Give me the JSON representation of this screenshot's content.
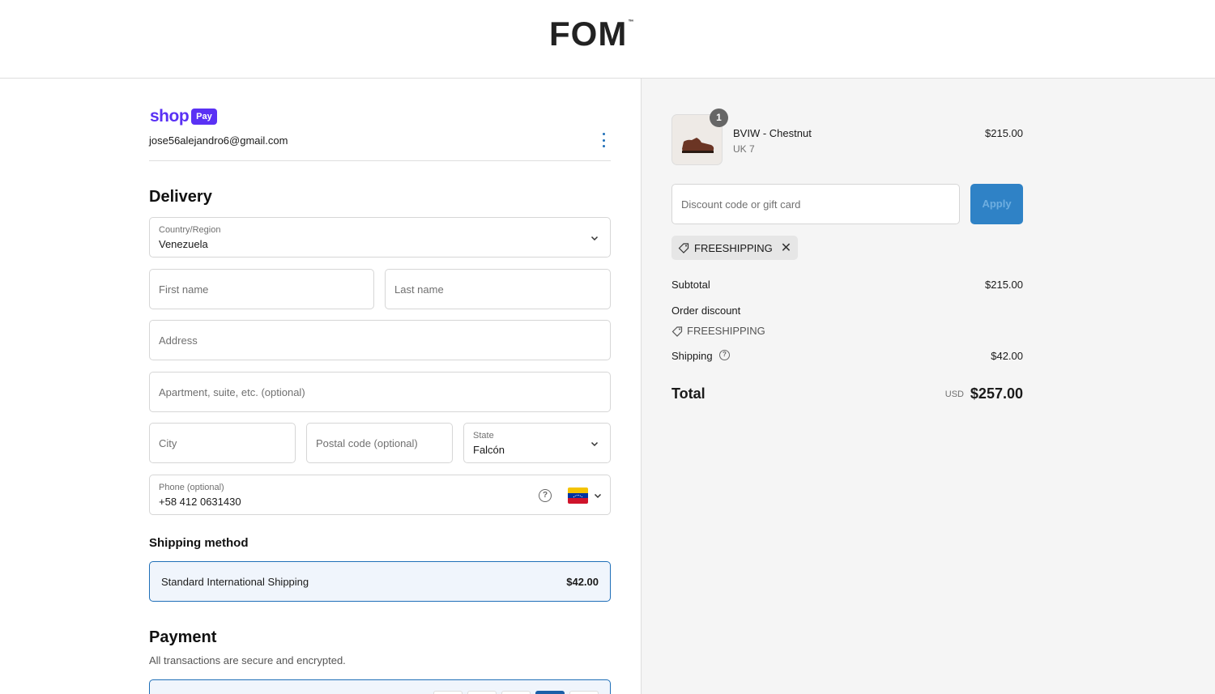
{
  "header": {
    "logo": "FOM",
    "trademark": "™"
  },
  "account": {
    "shop_word": "shop",
    "pay_badge": "Pay",
    "email": "jose56alejandro6@gmail.com"
  },
  "delivery": {
    "heading": "Delivery",
    "country_label": "Country/Region",
    "country_value": "Venezuela",
    "first_name_placeholder": "First name",
    "last_name_placeholder": "Last name",
    "address_placeholder": "Address",
    "apartment_placeholder": "Apartment, suite, etc. (optional)",
    "city_placeholder": "City",
    "postal_placeholder": "Postal code (optional)",
    "state_label": "State",
    "state_value": "Falcón",
    "phone_label": "Phone (optional)",
    "phone_value": "+58 412 0631430"
  },
  "shipping_method": {
    "heading": "Shipping method",
    "option_name": "Standard International Shipping",
    "option_price": "$42.00"
  },
  "payment": {
    "heading": "Payment",
    "subtitle": "All transactions are secure and encrypted."
  },
  "summary": {
    "item": {
      "quantity": "1",
      "name": "BVIW - Chestnut",
      "variant": "UK 7",
      "price": "$215.00"
    },
    "discount_placeholder": "Discount code or gift card",
    "apply_label": "Apply",
    "applied_code": "FREESHIPPING",
    "subtotal_label": "Subtotal",
    "subtotal_value": "$215.00",
    "order_discount_label": "Order discount",
    "order_discount_code": "FREESHIPPING",
    "shipping_label": "Shipping",
    "shipping_value": "$42.00",
    "total_label": "Total",
    "currency": "USD",
    "total_value": "$257.00"
  },
  "colors": {
    "accent": "#1f6fb8",
    "shop_pay": "#5a31f4",
    "apply_button": "#2f82c6"
  }
}
